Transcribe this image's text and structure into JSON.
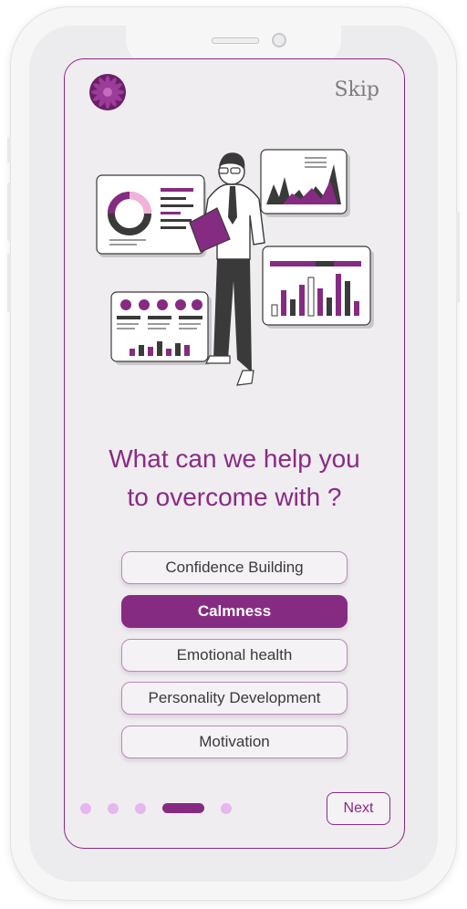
{
  "header": {
    "skip_label": "Skip"
  },
  "question": {
    "line1": "What can we help you",
    "line2": "to overcome with ?"
  },
  "options": [
    {
      "label": "Confidence Building",
      "selected": false
    },
    {
      "label": "Calmness",
      "selected": true
    },
    {
      "label": "Emotional health",
      "selected": false
    },
    {
      "label": "Personality Development",
      "selected": false
    },
    {
      "label": "Motivation",
      "selected": false
    }
  ],
  "pagination": {
    "total": 5,
    "current": 4
  },
  "footer": {
    "next_label": "Next"
  },
  "colors": {
    "accent": "#862b82",
    "dot_inactive": "#e6b7ee",
    "background": "#efedf0"
  },
  "icons": {
    "logo": "purple-flower-icon"
  }
}
